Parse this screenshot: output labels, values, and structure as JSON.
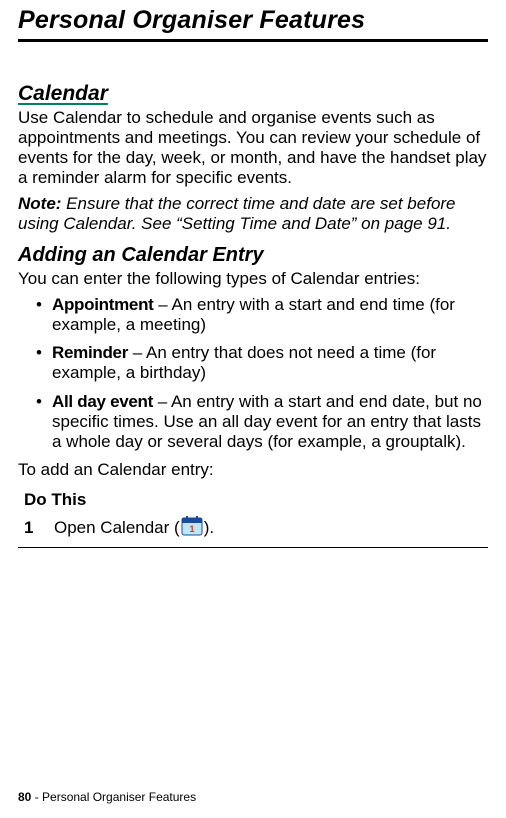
{
  "title": "Personal Organiser Features",
  "calendar": {
    "heading": "Calendar",
    "intro": "Use Calendar to schedule and organise events such as appointments and meetings. You can review your schedule of events for the day, week, or month, and have the handset play a reminder alarm for specific events.",
    "note_label": "Note:",
    "note_text": " Ensure that the correct time and date are set before using Calendar. See “Setting Time and Date” on page 91."
  },
  "adding": {
    "heading": "Adding an Calendar Entry",
    "intro": "You can enter the following types of Calendar entries:",
    "bullets": [
      {
        "label": "Appointment",
        "text": " – An entry with a start and end time (for example, a meeting)"
      },
      {
        "label": "Reminder",
        "text": " – An entry that does not need a time (for example, a birthday)"
      },
      {
        "label": "All day event",
        "text": " – An entry with a start and end date, but no specific times. Use an all day event for an entry that lasts a whole day or several days (for example, a grouptalk)."
      }
    ],
    "to_add": "To add an Calendar entry:"
  },
  "steps": {
    "header": "Do This",
    "rows": [
      {
        "num": "1",
        "before": "Open Calendar (",
        "after": ")."
      }
    ]
  },
  "footer": {
    "page_num": "80",
    "sep": " - ",
    "section": "Personal Organiser Features"
  }
}
